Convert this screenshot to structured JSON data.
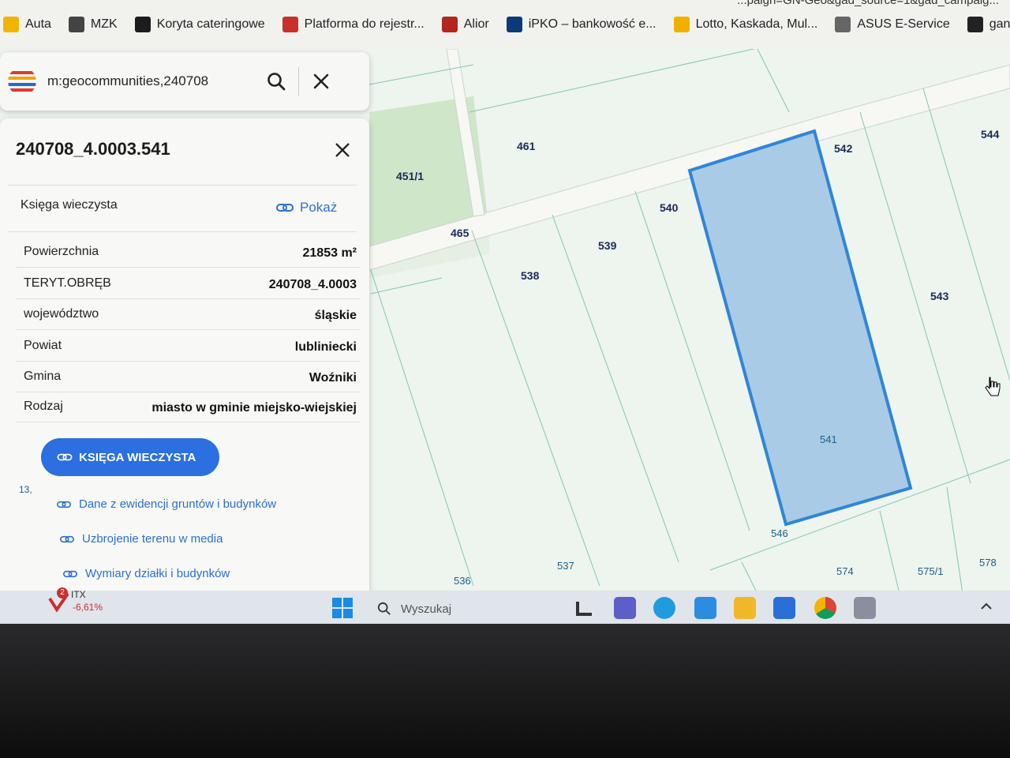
{
  "url_fragment": "...paign=GN-Geo&gad_source=1&gad_campaig...",
  "bookmarks": [
    {
      "label": "Auta",
      "color": "#f2b400"
    },
    {
      "label": "MZK",
      "color": "#444444"
    },
    {
      "label": "Koryta cateringowe",
      "color": "#1c1c1c"
    },
    {
      "label": "Platforma do rejestr...",
      "color": "#c8302c"
    },
    {
      "label": "Alior",
      "color": "#b3261e"
    },
    {
      "label": "iPKO – bankowość e...",
      "color": "#0a3a7a"
    },
    {
      "label": "Lotto, Kaskada, Mul...",
      "color": "#f0b000"
    },
    {
      "label": "ASUS E-Service",
      "color": "#666666"
    },
    {
      "label": "ganbanyoku-l",
      "color": "#222222"
    }
  ],
  "search": {
    "query": "m:geocommunities,240708"
  },
  "panel": {
    "title": "240708_4.0003.541",
    "kw_label": "Księga wieczysta",
    "kw_link": "Pokaż",
    "attributes": [
      {
        "key": "Powierzchnia",
        "value": "21853 m²"
      },
      {
        "key": "TERYT.OBRĘB",
        "value": "240708_4.0003"
      },
      {
        "key": "województwo",
        "value": "śląskie"
      },
      {
        "key": "Powiat",
        "value": "lubliniecki"
      },
      {
        "key": "Gmina",
        "value": "Woźniki"
      },
      {
        "key": "Rodzaj",
        "value": "miasto w gminie miejsko-wiejskiej"
      }
    ],
    "cta_label": "KSIĘGA WIECZYSTA",
    "links": [
      "Dane z ewidencji gruntów i budynków",
      "Uzbrojenie terenu w media",
      "Wymiary działki i budynków"
    ],
    "side_fragment": "13,"
  },
  "map": {
    "plots": [
      "461",
      "451/1",
      "465",
      "542",
      "544",
      "540",
      "539",
      "538",
      "543",
      "541",
      "546",
      "537",
      "536",
      "574",
      "575/1",
      "578"
    ],
    "selected_plot": "541",
    "colors": {
      "background": "#eef4ee",
      "meadow": "#c9e3c2",
      "lines": "#7fc8b4",
      "selection_fill": "#a9cbe6",
      "selection_stroke": "#2f86d6"
    }
  },
  "taskbar": {
    "search_placeholder": "Wyszukaj",
    "stock_name": "ITX",
    "stock_change": "-6,61%",
    "stock_badge": "2"
  }
}
